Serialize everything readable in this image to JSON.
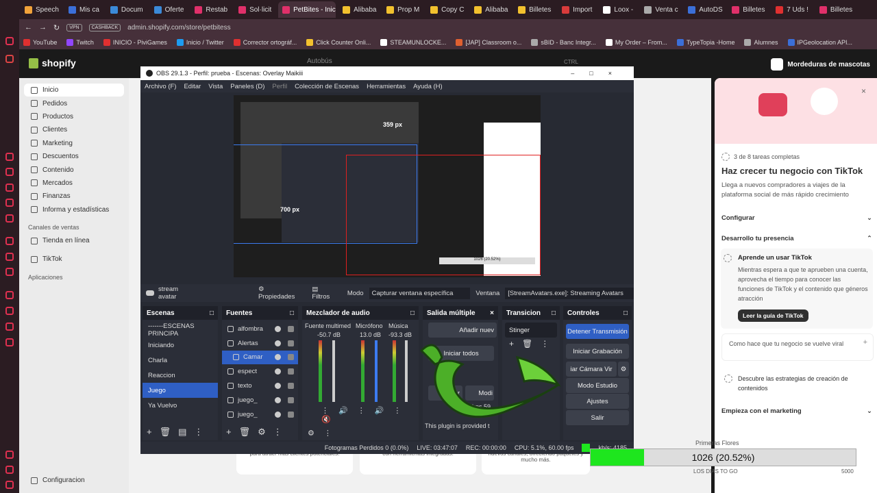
{
  "browser": {
    "tabs": [
      {
        "label": "Speech",
        "color": "#f2a33a"
      },
      {
        "label": "Mis ca",
        "color": "#3b6fd8"
      },
      {
        "label": "Docum",
        "color": "#3b8ad8"
      },
      {
        "label": "Oferte",
        "color": "#3b8ad8"
      },
      {
        "label": "Restab",
        "color": "#e0306a"
      },
      {
        "label": "Sol·licit",
        "color": "#e0306a"
      },
      {
        "label": "PetBites - Inicio",
        "color": "#e0306a",
        "active": true
      },
      {
        "label": "Alibaba",
        "color": "#f2c12e"
      },
      {
        "label": "Prop M",
        "color": "#f2c12e"
      },
      {
        "label": "Copy C",
        "color": "#f2c12e"
      },
      {
        "label": "Alibaba",
        "color": "#f2c12e"
      },
      {
        "label": "Billetes",
        "color": "#f2c12e"
      },
      {
        "label": "Import",
        "color": "#d83b3b"
      },
      {
        "label": "Loox -",
        "color": "#ffffff"
      },
      {
        "label": "Venta c",
        "color": "#aaaaaa"
      },
      {
        "label": "AutoDS",
        "color": "#3b6fd8"
      },
      {
        "label": "Billetes",
        "color": "#e0306a"
      },
      {
        "label": "7 Uds !",
        "color": "#e03030"
      },
      {
        "label": "Billetes",
        "color": "#e0306a"
      }
    ],
    "url": "admin.shopify.com/store/petbitess",
    "vpn_chip": "VPN",
    "cashback_chip": "CASHBACK",
    "bookmarks": [
      {
        "label": "YouTube",
        "color": "#e03030"
      },
      {
        "label": "Twitch",
        "color": "#9146ff"
      },
      {
        "label": "INICIO - PiviGames",
        "color": "#e03030"
      },
      {
        "label": "Inicio / Twitter",
        "color": "#1d9bf0"
      },
      {
        "label": "Corrector ortográf...",
        "color": "#e03030"
      },
      {
        "label": "Click Counter Onli...",
        "color": "#f2c12e"
      },
      {
        "label": "STEAMUNLOCKE...",
        "color": "#ffffff"
      },
      {
        "label": "[JAP] Classroom o...",
        "color": "#e06030"
      },
      {
        "label": "sBID - Banc Integr...",
        "color": "#aaaaaa"
      },
      {
        "label": "My Order – From...",
        "color": "#ffffff"
      },
      {
        "label": "TypeTopia -Home",
        "color": "#3b6fd8"
      },
      {
        "label": "Alumnes",
        "color": "#aaaaaa"
      },
      {
        "label": "IPGeolocation API...",
        "color": "#3b6fd8"
      }
    ]
  },
  "shopify": {
    "logo": "shopify",
    "search_placeholder": "Autobús",
    "search_shortcut": "CTRL",
    "store_name": "Mordeduras de mascotas",
    "nav": [
      "Inicio",
      "Pedidos",
      "Productos",
      "Clientes",
      "Marketing",
      "Descuentos",
      "Contenido",
      "Mercados",
      "Finanzas",
      "Informa y estadísticas"
    ],
    "channels_label": "Canales de ventas",
    "channels": [
      "Tienda en línea",
      "TikTok"
    ],
    "apps_label": "Aplicaciones",
    "settings": "Configuracion",
    "cards": [
      "para atraer más clientes potenciales.",
      "con herramientas integradas.",
      "nuevos canales, ofreciendo paquetes y mucho más."
    ]
  },
  "tiktok": {
    "progress": "3 de 8 tareas completas",
    "title": "Haz crecer tu negocio con TikTok",
    "subtitle": "Llega a nuevos compradores a viajes de la plataforma social de más rápido crecimiento",
    "configure": "Configurar",
    "develop": "Desarrollo tu presencia",
    "task1_title": "Aprende un usar TikTok",
    "task1_body": "Mientras espera a que te aprueben una cuenta, aprovecha el tiempo para conocer las funciones de TikTok y el contenido que géneros atracción",
    "task1_button": "Leer la guía de TikTok",
    "task2": "Como hace que tu negocio se vuelve viral",
    "task3": "Descubre las estrategias de creación de contenidos",
    "marketing": "Empieza con el marketing"
  },
  "obs": {
    "title": "OBS 29.1.3 - Perfil: prueba - Escenas: Overlay Maikiii",
    "menu": [
      "Archivo (F)",
      "Editar",
      "Vista",
      "Paneles (D)",
      "Perfil",
      "Colección de Escenas",
      "Herramientas",
      "Ayuda (H)"
    ],
    "preview_labels": {
      "px_a": "359 px",
      "px_b": "700 px",
      "counter": "1026 (20.52%)"
    },
    "source_name": "stream avatar",
    "properties": "Propiedades",
    "filters": "Filtros",
    "mode_label": "Modo",
    "mode_value": "Capturar ventana específica",
    "window_label": "Ventana",
    "window_value": "[StreamAvatars.exe]: Streaming Avatars",
    "scenes_title": "Escenas",
    "scenes": [
      "-------ESCENAS PRINCIPA",
      "Iniciando",
      "Charla",
      "Reaccion",
      "Juego",
      "Ya Vuelvo"
    ],
    "sources_title": "Fuentes",
    "sources": [
      "alfombra",
      "Alertas",
      "Camar",
      "espect",
      "texto",
      "juego_",
      "juego_"
    ],
    "mixer_title": "Mezclador de audio",
    "mixer": [
      {
        "name": "Fuente multimed",
        "db": "-50.7 dB"
      },
      {
        "name": "Micrófono",
        "db": "13.0 dB"
      },
      {
        "name": "Música",
        "db": "-93.3 dB"
      }
    ],
    "multi_title": "Salida múltiple",
    "multi_add": "Añadir nuev",
    "multi_start": "Iniciar todos",
    "multi_stop": "tener",
    "multi_mod": "Modi",
    "multi_note": "This plugin is provided t",
    "multi_kbps": "bps 59",
    "trans_title": "Transicion",
    "trans_value": "Stinger",
    "controls_title": "Controles",
    "controls": [
      "Detener Transmisión",
      "Iniciar Grabación",
      "iar Cámara Vir",
      "Modo Estudio",
      "Ajustes",
      "Salir"
    ],
    "status": {
      "dropped": "Fotogramas Perdidos 0 (0.0%)",
      "live": "LIVE: 03:47:07",
      "rec": "REC: 00:00:00",
      "cpu": "CPU: 5.1%, 60.00 fps",
      "kbps": "kb/s: 4185"
    }
  },
  "counter": {
    "text": "1026 (20.52%)",
    "fraction": 0.2052,
    "label_top": "Primeras Flores",
    "label_bottom": "LOS DIAS TO GO",
    "label_right": "5000"
  }
}
